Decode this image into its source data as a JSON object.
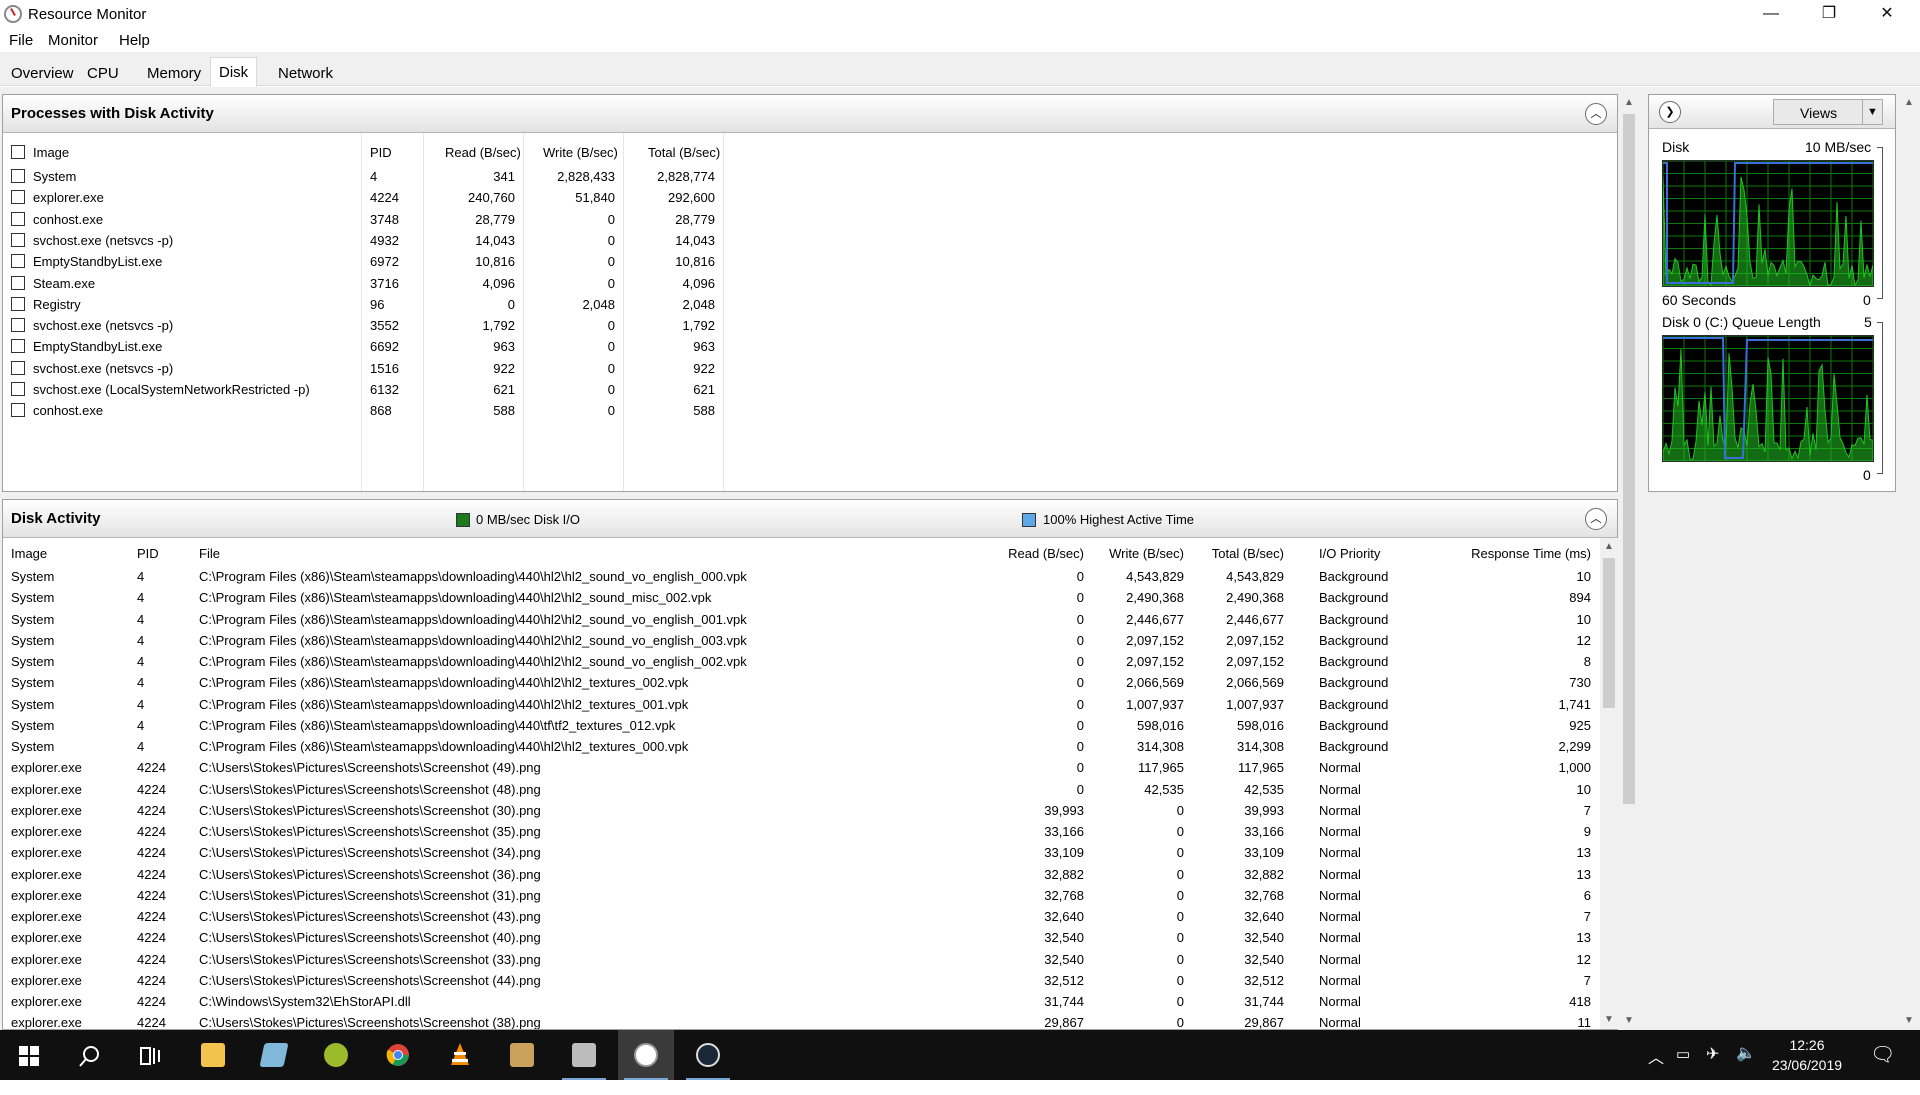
{
  "window": {
    "title": "Resource Monitor",
    "minimize_glyph": "—",
    "restore_glyph": "❐",
    "close_glyph": "✕"
  },
  "menu": [
    "File",
    "Monitor",
    "Help"
  ],
  "tabs": [
    "Overview",
    "CPU",
    "Memory",
    "Disk",
    "Network"
  ],
  "active_tab": "Disk",
  "processes": {
    "title": "Processes with Disk Activity",
    "columns": [
      "Image",
      "PID",
      "Read (B/sec)",
      "Write (B/sec)",
      "Total (B/sec)"
    ],
    "rows": [
      [
        "System",
        "4",
        "341",
        "2,828,433",
        "2,828,774"
      ],
      [
        "explorer.exe",
        "4224",
        "240,760",
        "51,840",
        "292,600"
      ],
      [
        "conhost.exe",
        "3748",
        "28,779",
        "0",
        "28,779"
      ],
      [
        "svchost.exe (netsvcs -p)",
        "4932",
        "14,043",
        "0",
        "14,043"
      ],
      [
        "EmptyStandbyList.exe",
        "6972",
        "10,816",
        "0",
        "10,816"
      ],
      [
        "Steam.exe",
        "3716",
        "4,096",
        "0",
        "4,096"
      ],
      [
        "Registry",
        "96",
        "0",
        "2,048",
        "2,048"
      ],
      [
        "svchost.exe (netsvcs -p)",
        "3552",
        "1,792",
        "0",
        "1,792"
      ],
      [
        "EmptyStandbyList.exe",
        "6692",
        "963",
        "0",
        "963"
      ],
      [
        "svchost.exe (netsvcs -p)",
        "1516",
        "922",
        "0",
        "922"
      ],
      [
        "svchost.exe (LocalSystemNetworkRestricted -p)",
        "6132",
        "621",
        "0",
        "621"
      ],
      [
        "conhost.exe",
        "868",
        "588",
        "0",
        "588"
      ]
    ]
  },
  "disk_activity": {
    "title": "Disk Activity",
    "legend_io": "0 MB/sec Disk I/O",
    "legend_active": "100% Highest Active Time",
    "legend_io_color": "#1b7a1b",
    "legend_active_color": "#5fa8e8",
    "columns": [
      "Image",
      "PID",
      "File",
      "Read (B/sec)",
      "Write (B/sec)",
      "Total (B/sec)",
      "I/O Priority",
      "Response Time (ms)"
    ],
    "rows": [
      [
        "System",
        "4",
        "C:\\Program Files (x86)\\Steam\\steamapps\\downloading\\440\\hl2\\hl2_sound_vo_english_000.vpk",
        "0",
        "4,543,829",
        "4,543,829",
        "Background",
        "10"
      ],
      [
        "System",
        "4",
        "C:\\Program Files (x86)\\Steam\\steamapps\\downloading\\440\\hl2\\hl2_sound_misc_002.vpk",
        "0",
        "2,490,368",
        "2,490,368",
        "Background",
        "894"
      ],
      [
        "System",
        "4",
        "C:\\Program Files (x86)\\Steam\\steamapps\\downloading\\440\\hl2\\hl2_sound_vo_english_001.vpk",
        "0",
        "2,446,677",
        "2,446,677",
        "Background",
        "10"
      ],
      [
        "System",
        "4",
        "C:\\Program Files (x86)\\Steam\\steamapps\\downloading\\440\\hl2\\hl2_sound_vo_english_003.vpk",
        "0",
        "2,097,152",
        "2,097,152",
        "Background",
        "12"
      ],
      [
        "System",
        "4",
        "C:\\Program Files (x86)\\Steam\\steamapps\\downloading\\440\\hl2\\hl2_sound_vo_english_002.vpk",
        "0",
        "2,097,152",
        "2,097,152",
        "Background",
        "8"
      ],
      [
        "System",
        "4",
        "C:\\Program Files (x86)\\Steam\\steamapps\\downloading\\440\\hl2\\hl2_textures_002.vpk",
        "0",
        "2,066,569",
        "2,066,569",
        "Background",
        "730"
      ],
      [
        "System",
        "4",
        "C:\\Program Files (x86)\\Steam\\steamapps\\downloading\\440\\hl2\\hl2_textures_001.vpk",
        "0",
        "1,007,937",
        "1,007,937",
        "Background",
        "1,741"
      ],
      [
        "System",
        "4",
        "C:\\Program Files (x86)\\Steam\\steamapps\\downloading\\440\\tf\\tf2_textures_012.vpk",
        "0",
        "598,016",
        "598,016",
        "Background",
        "925"
      ],
      [
        "System",
        "4",
        "C:\\Program Files (x86)\\Steam\\steamapps\\downloading\\440\\hl2\\hl2_textures_000.vpk",
        "0",
        "314,308",
        "314,308",
        "Background",
        "2,299"
      ],
      [
        "explorer.exe",
        "4224",
        "C:\\Users\\Stokes\\Pictures\\Screenshots\\Screenshot (49).png",
        "0",
        "117,965",
        "117,965",
        "Normal",
        "1,000"
      ],
      [
        "explorer.exe",
        "4224",
        "C:\\Users\\Stokes\\Pictures\\Screenshots\\Screenshot (48).png",
        "0",
        "42,535",
        "42,535",
        "Normal",
        "10"
      ],
      [
        "explorer.exe",
        "4224",
        "C:\\Users\\Stokes\\Pictures\\Screenshots\\Screenshot (30).png",
        "39,993",
        "0",
        "39,993",
        "Normal",
        "7"
      ],
      [
        "explorer.exe",
        "4224",
        "C:\\Users\\Stokes\\Pictures\\Screenshots\\Screenshot (35).png",
        "33,166",
        "0",
        "33,166",
        "Normal",
        "9"
      ],
      [
        "explorer.exe",
        "4224",
        "C:\\Users\\Stokes\\Pictures\\Screenshots\\Screenshot (34).png",
        "33,109",
        "0",
        "33,109",
        "Normal",
        "13"
      ],
      [
        "explorer.exe",
        "4224",
        "C:\\Users\\Stokes\\Pictures\\Screenshots\\Screenshot (36).png",
        "32,882",
        "0",
        "32,882",
        "Normal",
        "13"
      ],
      [
        "explorer.exe",
        "4224",
        "C:\\Users\\Stokes\\Pictures\\Screenshots\\Screenshot (31).png",
        "32,768",
        "0",
        "32,768",
        "Normal",
        "6"
      ],
      [
        "explorer.exe",
        "4224",
        "C:\\Users\\Stokes\\Pictures\\Screenshots\\Screenshot (43).png",
        "32,640",
        "0",
        "32,640",
        "Normal",
        "7"
      ],
      [
        "explorer.exe",
        "4224",
        "C:\\Users\\Stokes\\Pictures\\Screenshots\\Screenshot (40).png",
        "32,540",
        "0",
        "32,540",
        "Normal",
        "13"
      ],
      [
        "explorer.exe",
        "4224",
        "C:\\Users\\Stokes\\Pictures\\Screenshots\\Screenshot (33).png",
        "32,540",
        "0",
        "32,540",
        "Normal",
        "12"
      ],
      [
        "explorer.exe",
        "4224",
        "C:\\Users\\Stokes\\Pictures\\Screenshots\\Screenshot (44).png",
        "32,512",
        "0",
        "32,512",
        "Normal",
        "7"
      ],
      [
        "explorer.exe",
        "4224",
        "C:\\Windows\\System32\\EhStorAPI.dll",
        "31,744",
        "0",
        "31,744",
        "Normal",
        "418"
      ],
      [
        "explorer.exe",
        "4224",
        "C:\\Users\\Stokes\\Pictures\\Screenshots\\Screenshot (38).png",
        "29,867",
        "0",
        "29,867",
        "Normal",
        "11"
      ]
    ]
  },
  "right_panel": {
    "views_label": "Views",
    "disk_graph": {
      "title": "Disk",
      "max_label": "10 MB/sec",
      "time_label": "60 Seconds",
      "min_label": "0"
    },
    "queue_graph": {
      "title": "Disk 0 (C:) Queue Length",
      "max_label": "5",
      "min_label": "0"
    }
  },
  "colors": {
    "graph_green": "#22c322",
    "graph_blue": "#3b6fd8",
    "graph_grid": "#0a7a0a"
  },
  "taskbar": {
    "time": "12:26",
    "date": "23/06/2019",
    "apps": [
      "start-icon",
      "search-icon",
      "task-view-icon",
      "file-explorer-icon",
      "notepad-icon",
      "unknown-app-icon",
      "chrome-icon",
      "vlc-icon",
      "paint-icon",
      "drive-icon",
      "resource-monitor-icon",
      "steam-icon"
    ]
  }
}
